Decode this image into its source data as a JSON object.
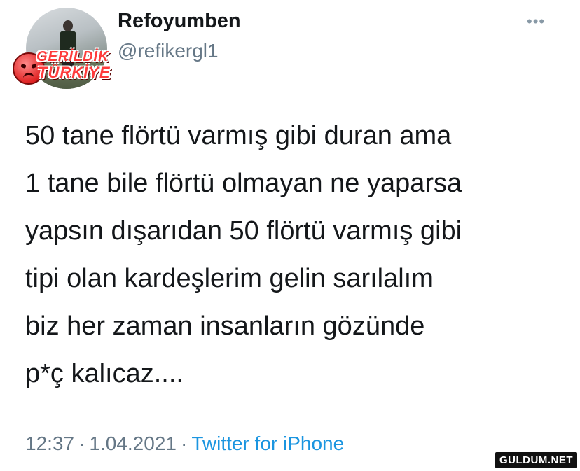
{
  "tweet": {
    "display_name": "Refoyumben",
    "handle": "@refikergl1",
    "more_icon": "more-horizontal-icon",
    "text_lines": [
      "50 tane flörtü varmış gibi duran ama",
      "1 tane bile flörtü olmayan ne yaparsa",
      "yapsın dışarıdan 50 flörtü varmış gibi",
      "tipi olan kardeşlerim gelin sarılalım",
      "biz her zaman insanların gözünde",
      "p*ç kalıcaz...."
    ],
    "time": "12:37",
    "date": "1.04.2021",
    "separator": "·",
    "source": "Twitter for iPhone"
  },
  "overlay_badge": {
    "line1": "GERİLDİK",
    "line2": "TÜRKİYE"
  },
  "watermark": "GULDUM.NET",
  "colors": {
    "text": "#14171a",
    "secondary": "#657786",
    "link": "#1b95e0",
    "badge_red": "#ff3b3b"
  }
}
